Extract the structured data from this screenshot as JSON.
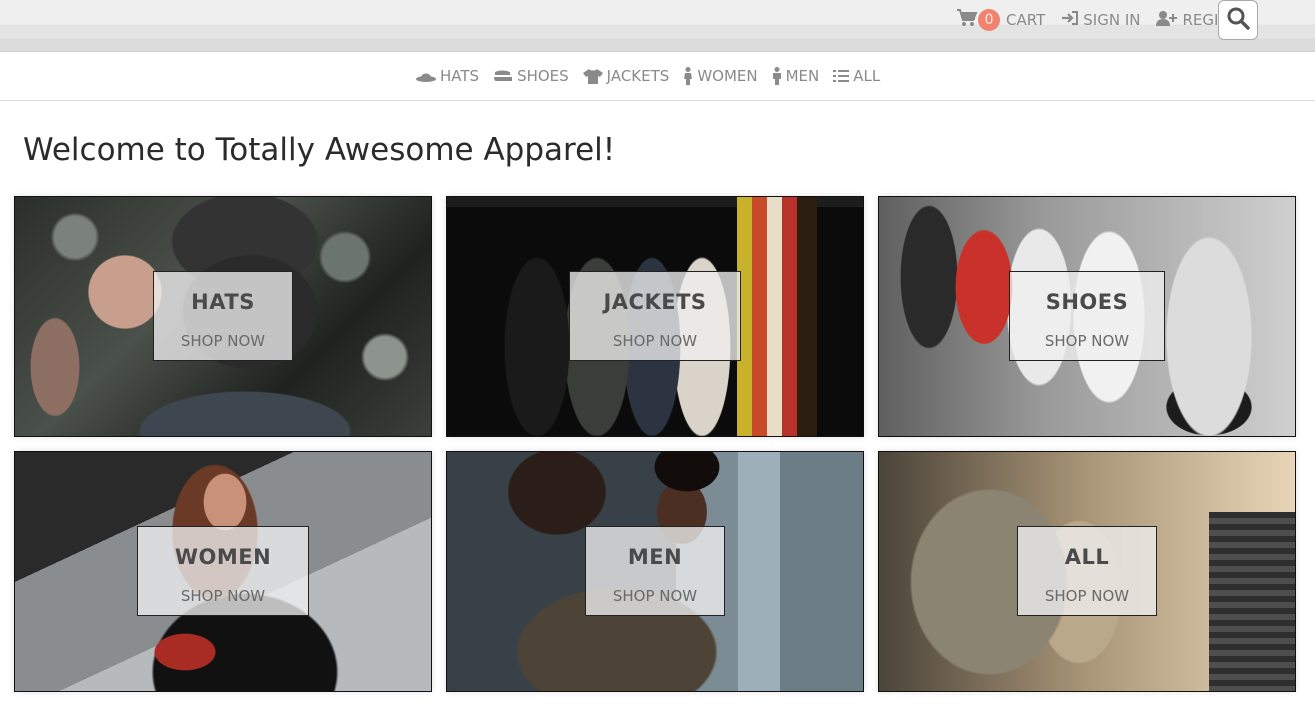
{
  "header": {
    "cart_count": "0",
    "cart_label": "CART",
    "signin_label": "SIGN IN",
    "register_label": "REGISTER"
  },
  "nav": {
    "items": [
      {
        "label": "HATS",
        "icon": "hat-icon"
      },
      {
        "label": "SHOES",
        "icon": "shoe-icon"
      },
      {
        "label": "JACKETS",
        "icon": "shirt-icon"
      },
      {
        "label": "WOMEN",
        "icon": "female-icon"
      },
      {
        "label": "MEN",
        "icon": "male-icon"
      },
      {
        "label": "ALL",
        "icon": "list-icon"
      }
    ]
  },
  "main": {
    "title": "Welcome to Totally Awesome Apparel!",
    "tiles": [
      {
        "title": "HATS",
        "cta": "SHOP NOW"
      },
      {
        "title": "JACKETS",
        "cta": "SHOP NOW"
      },
      {
        "title": "SHOES",
        "cta": "SHOP NOW"
      },
      {
        "title": "WOMEN",
        "cta": "SHOP NOW"
      },
      {
        "title": "MEN",
        "cta": "SHOP NOW"
      },
      {
        "title": "ALL",
        "cta": "SHOP NOW"
      }
    ]
  },
  "colors": {
    "badge": "#f0826e",
    "nav_text": "#8a8a8a",
    "heading": "#2b2b2b"
  }
}
